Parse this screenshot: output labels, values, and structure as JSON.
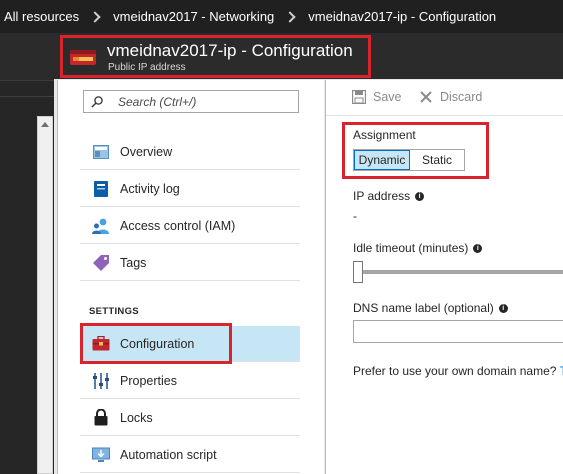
{
  "breadcrumb": {
    "items": [
      "All resources",
      "vmeidnav2017 - Networking",
      "vmeidnav2017-ip - Configuration"
    ]
  },
  "blade": {
    "title": "vmeidnav2017-ip - Configuration",
    "subtitle": "Public IP address"
  },
  "menu": {
    "search_placeholder": "Search (Ctrl+/)",
    "items": [
      {
        "label": "Overview",
        "icon": "overview-icon"
      },
      {
        "label": "Activity log",
        "icon": "activity-log-icon"
      },
      {
        "label": "Access control (IAM)",
        "icon": "iam-icon"
      },
      {
        "label": "Tags",
        "icon": "tag-icon"
      }
    ],
    "settings_label": "SETTINGS",
    "settings_items": [
      {
        "label": "Configuration",
        "icon": "toolbox-icon",
        "selected": true
      },
      {
        "label": "Properties",
        "icon": "sliders-icon"
      },
      {
        "label": "Locks",
        "icon": "lock-icon"
      },
      {
        "label": "Automation script",
        "icon": "download-monitor-icon"
      }
    ]
  },
  "toolbar": {
    "save_label": "Save",
    "discard_label": "Discard"
  },
  "form": {
    "assignment_label": "Assignment",
    "assignment_options": [
      "Dynamic",
      "Static"
    ],
    "assignment_selected": "Dynamic",
    "ip_address_label": "IP address",
    "ip_address_value": "-",
    "idle_timeout_label": "Idle timeout (minutes)",
    "idle_timeout_level": 0,
    "dns_label": "DNS name label (optional)",
    "dns_value": "",
    "prefer_text": "Prefer to use your own domain name?",
    "prefer_link": "T"
  },
  "colors": {
    "highlight_red": "#d9232d",
    "selected_blue": "#c7e6f5",
    "accent_blue": "#0072c6",
    "top_bar": "#202020",
    "header_bar": "#2b2b2b"
  }
}
